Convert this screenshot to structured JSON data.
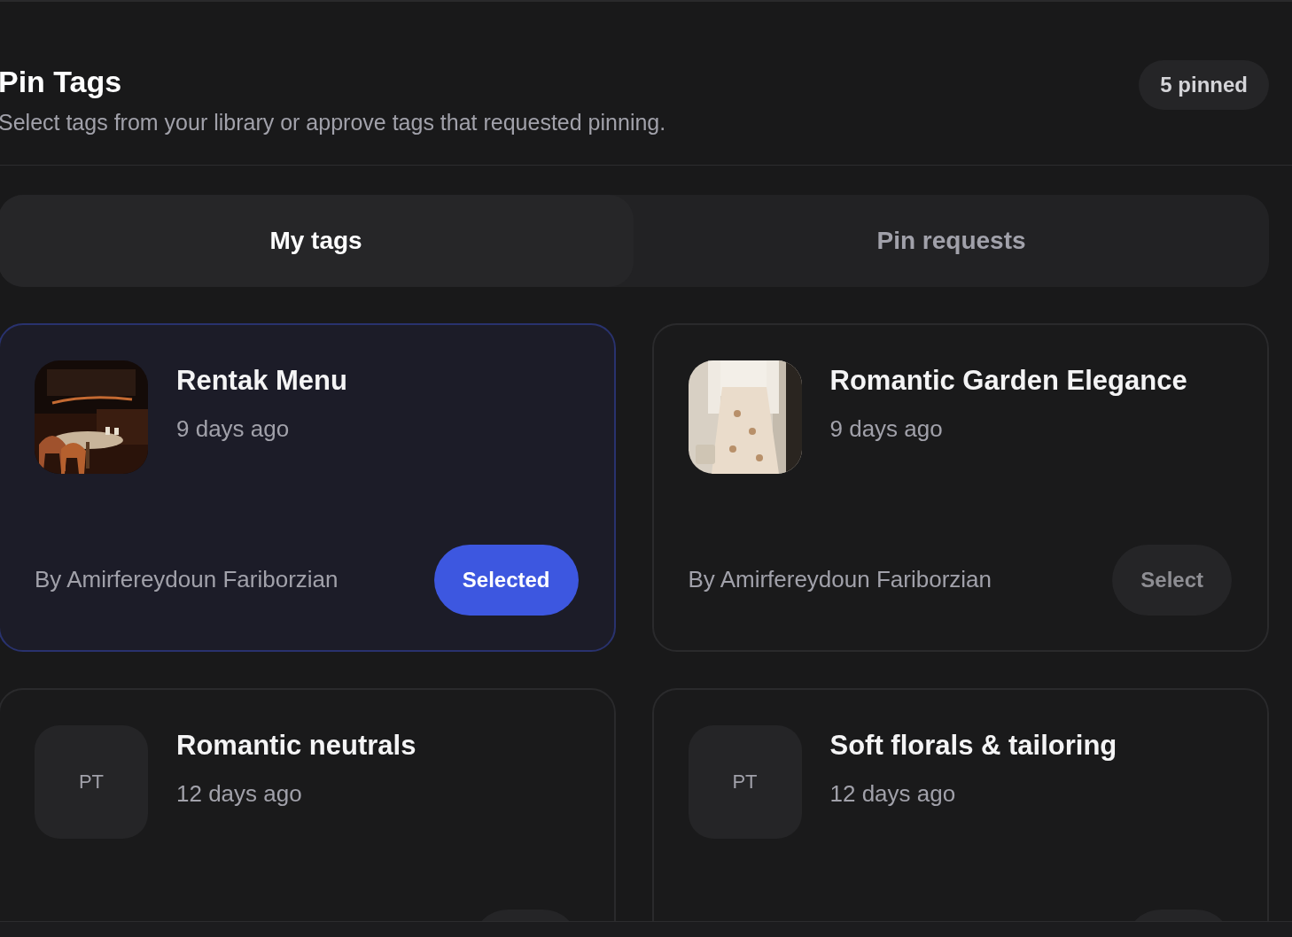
{
  "header": {
    "title": "Pin Tags",
    "subtitle": "Select tags from your library or approve tags that requested pinning.",
    "pinned_badge": "5 pinned"
  },
  "tabs": [
    {
      "label": "My tags",
      "selected": true
    },
    {
      "label": "Pin requests",
      "selected": false
    }
  ],
  "tags": [
    {
      "title": "Rentak Menu",
      "time": "9 days ago",
      "author": "By Amirfereydoun Fariborzian",
      "button": "Selected",
      "selected": true
    },
    {
      "title": "Romantic Garden Elegance",
      "time": "9 days ago",
      "author": "By Amirfereydoun Fariborzian",
      "button": "Select",
      "selected": false
    },
    {
      "title": "Romantic neutrals",
      "time": "12 days ago",
      "thumbnail": {
        "kind": "initials",
        "text": "PT"
      },
      "selected": false
    },
    {
      "title": "Soft florals & tailoring",
      "time": "12 days ago",
      "thumbnail": {
        "kind": "initials",
        "text": "PT"
      },
      "selected": false
    }
  ]
}
